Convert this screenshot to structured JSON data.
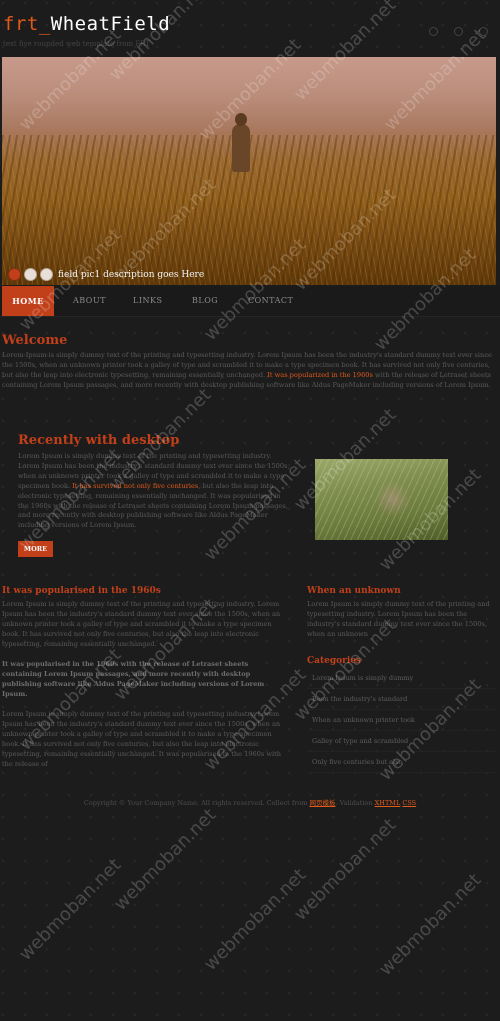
{
  "header": {
    "title_prefix": "frt_",
    "title_main": "WheatField",
    "subtitle": "text five rounded web template from FRT"
  },
  "hero": {
    "caption": "field pic1 description goes Here"
  },
  "nav": {
    "items": [
      "HOME",
      "ABOUT",
      "LINKS",
      "BLOG",
      "CONTACT"
    ]
  },
  "welcome": {
    "heading": "Welcome",
    "text_before": "Lorem Ipsum is simply dummy text of the printing and typesetting industry. Lorem Ipsum has been the industry's standard dummy text ever since the 1500s, when an unknown printer took a galley of type and scrambled it to make a type specimen book. It has survived not only five centuries, but also the leap into electronic typesetting, remaining essentially unchanged.",
    "highlight": "It was popularized in the 1960s",
    "text_after": "with the release of Letraset sheets containing Lorem Ipsum passages, and more recently with desktop publishing software like Aldus PageMaker including versions of Lorem Ipsum."
  },
  "desktop": {
    "heading": "Recently with desktop",
    "text_before": "Lorem Ipsum is simply dummy text of the printing and typesetting industry. Lorem Ipsum has been the industry's standard dummy text ever since the 1500s, when an unknown printer took a galley of type and scrambled it to make a type specimen book.",
    "highlight": "It has survived not only five centuries",
    "text_after": ", but also the leap into electronic typesetting, remaining essentially unchanged. It was popularised in the 1960s with the release of Letraset sheets containing Lorem Ipsum passages, and more recently with desktop publishing software like Aldus PageMaker including versions of Lorem Ipsum.",
    "more_label": "MORE"
  },
  "left": {
    "heading": "It was popularised in the 1960s",
    "para1": "Lorem Ipsum is simply dummy text of the printing and typesetting industry. Lorem Ipsum has been the industry's standard dummy text ever since the 1500s, when an unknown printer took a galley of type and scrambled it to make a type specimen book. It has survived not only five centuries, but also the leap into electronic typesetting, remaining essentially unchanged.",
    "para2": "It was popularised in the 1960s with the release of Letraset sheets containing Lorem Ipsum passages, and more recently with desktop publishing software like Aldus PageMaker including versions of Lorem Ipsum.",
    "para3": "Lorem Ipsum is simply dummy text of the printing and typesetting industry. Lorem Ipsum has been the industry's standard dummy text ever since the 1500s, when an unknown printer took a galley of type and scrambled it to make a type specimen book. It has survived not only five centuries, but also the leap into electronic typesetting, remaining essentially unchanged. It was popularised in the 1960s with the release of"
  },
  "right": {
    "heading": "When an unknown",
    "text": "Lorem Ipsum is simply dummy text of the printing and typesetting industry. Lorem Ipsum has been the industry's standard dummy text ever since the 1500s, when an unknown",
    "categories_heading": "Categories",
    "categories": [
      "Lorem Ipsum is simply dummy",
      "Been the industry's standard",
      "When an unknown printer took",
      "Galley of type and scrambled",
      "Only five centuries but also"
    ]
  },
  "footer": {
    "copyright": "Copyright © Your Company Name. All rights reserved. Collect from",
    "link1": "网页模板",
    "validation": ". Validation",
    "link2": "XHTML",
    "link3": "CSS"
  },
  "watermark": "webmoban.net"
}
